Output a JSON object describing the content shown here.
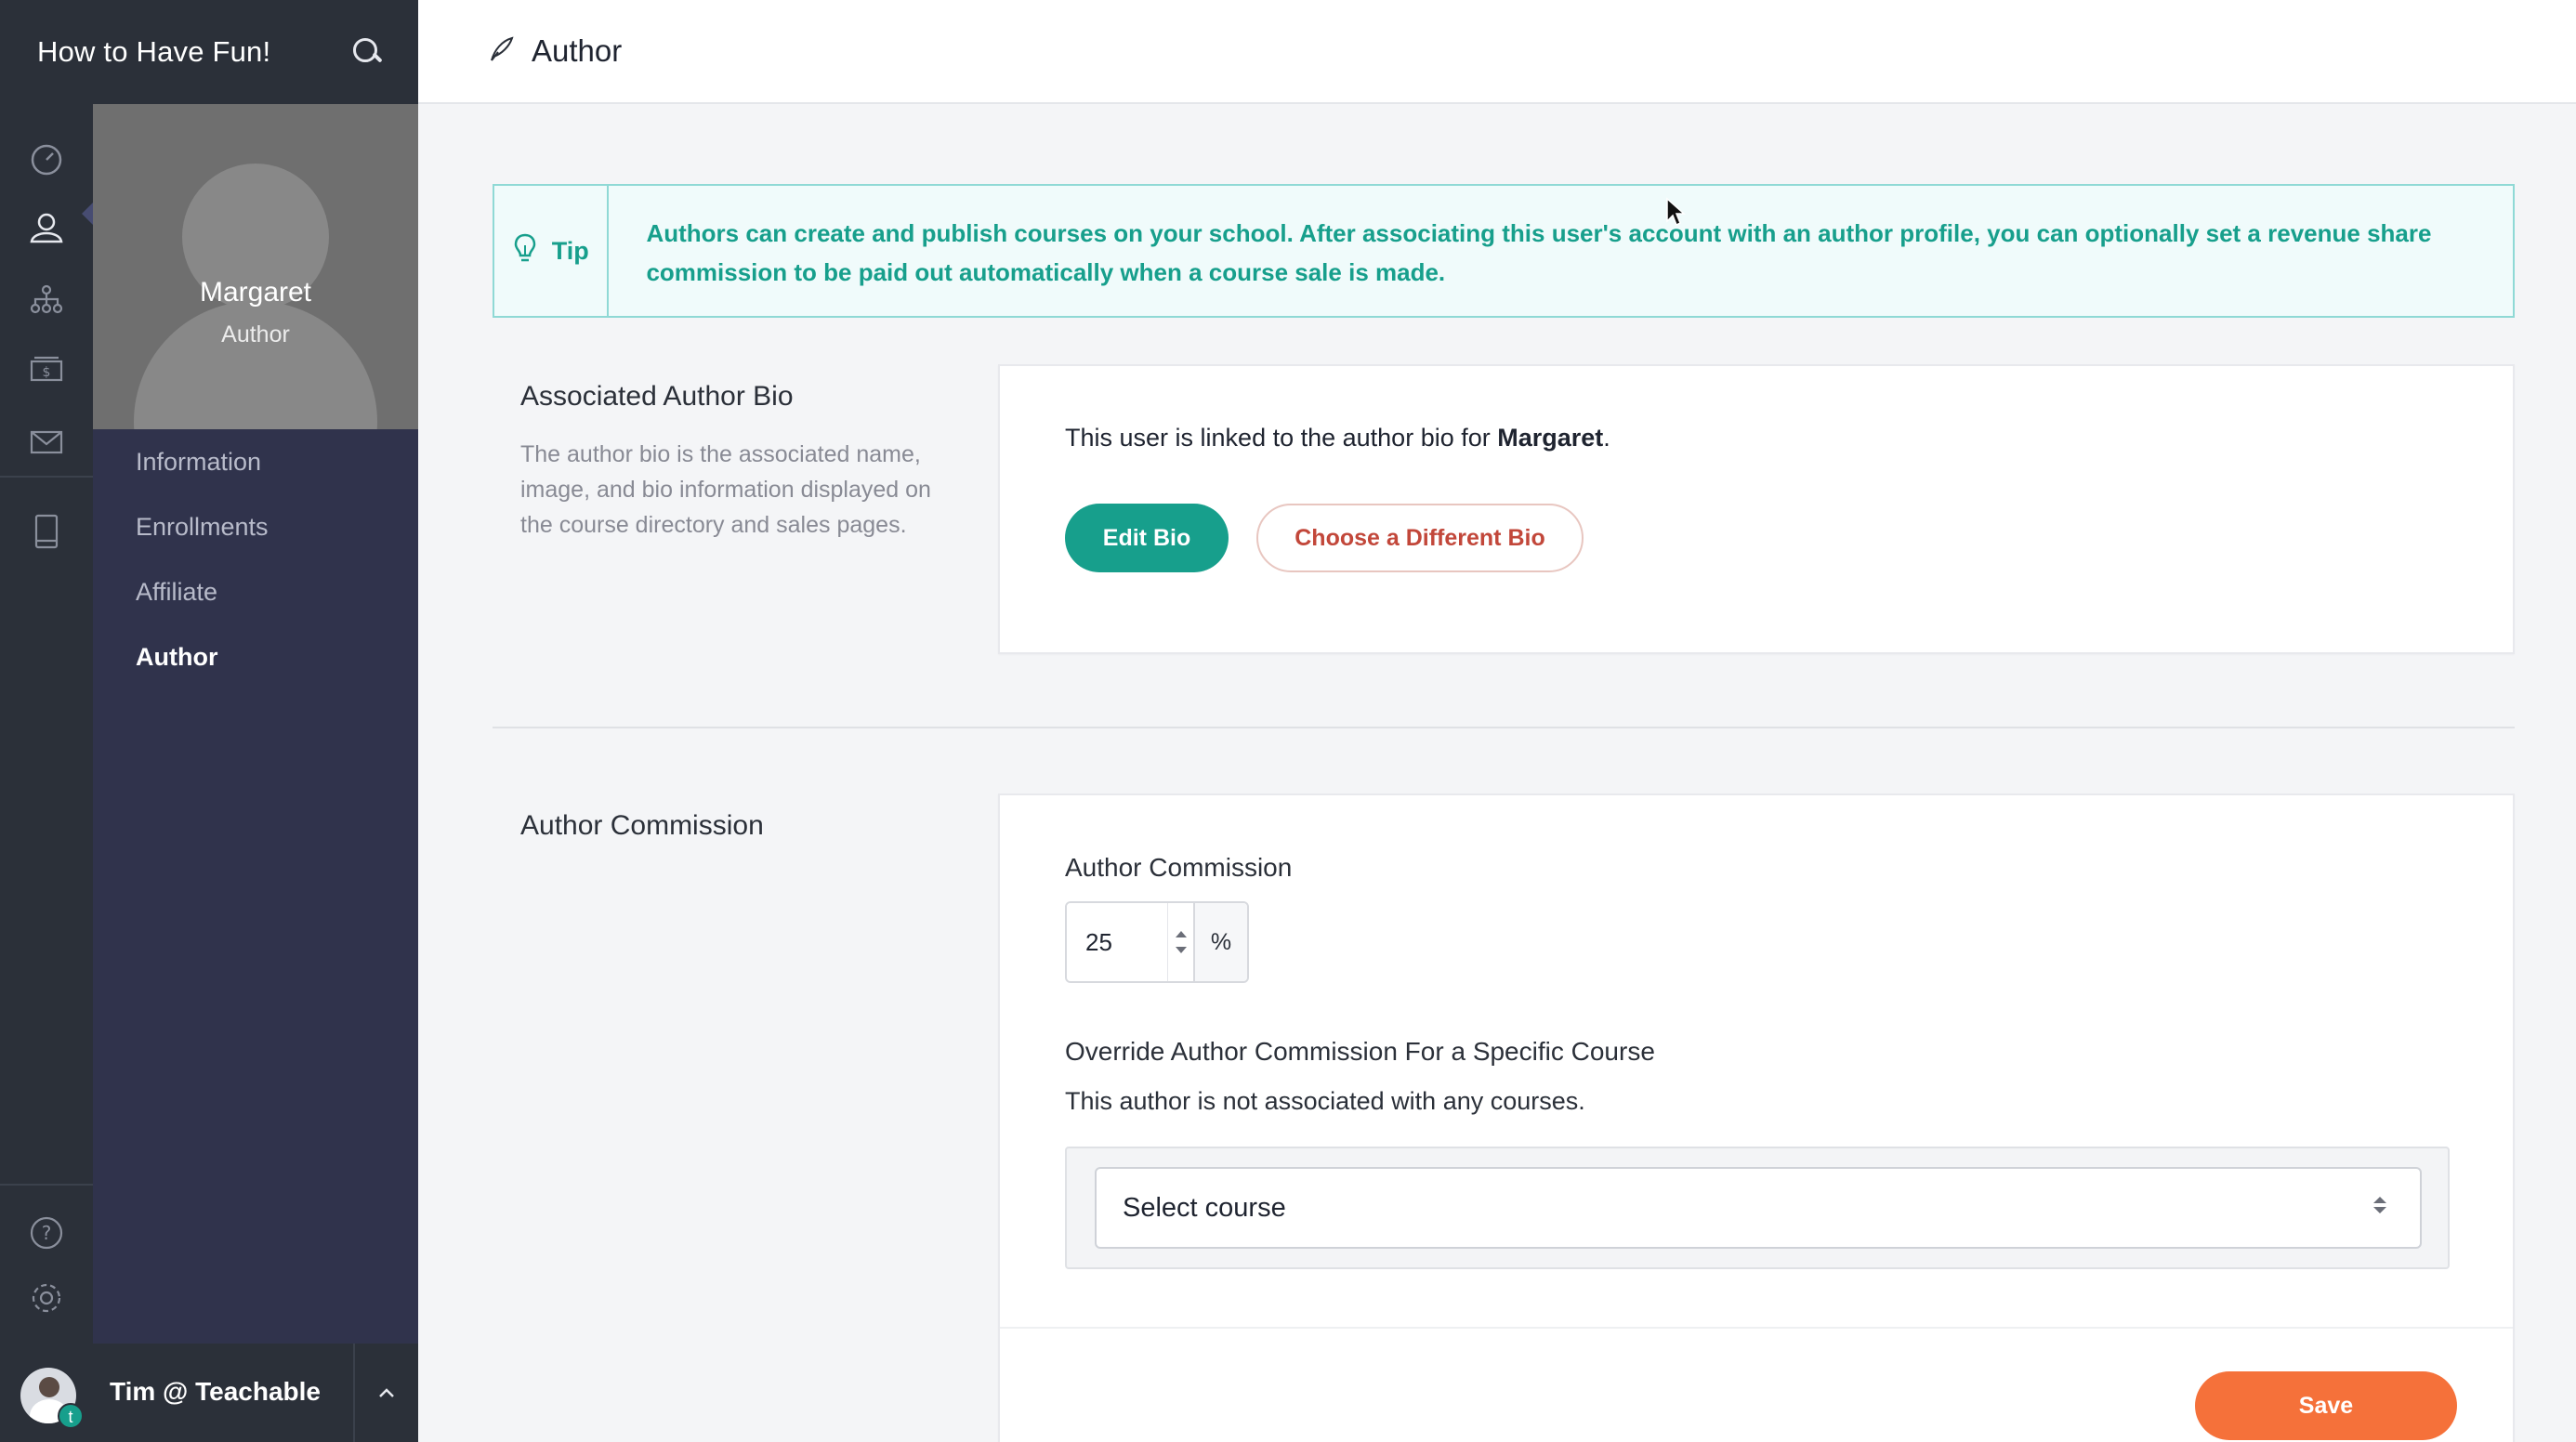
{
  "brand": {
    "title": "How to Have Fun!"
  },
  "rail": {
    "icons": [
      "dashboard-icon",
      "users-icon",
      "sitemap-icon",
      "money-icon",
      "mail-icon",
      "tablet-icon",
      "help-icon",
      "settings-icon"
    ]
  },
  "profile": {
    "name": "Margaret",
    "role": "Author"
  },
  "subnav": {
    "items": [
      {
        "label": "Information"
      },
      {
        "label": "Enrollments"
      },
      {
        "label": "Affiliate"
      },
      {
        "label": "Author"
      }
    ],
    "active": "Author"
  },
  "user": {
    "name": "Tim @ Teachable",
    "badge": "t"
  },
  "header": {
    "title": "Author",
    "icon": "quill-icon"
  },
  "tip": {
    "label": "Tip",
    "text": "Authors can create and publish courses on your school. After associating this user's account with an author profile, you can optionally set a revenue share commission to be paid out automatically when a course sale is made."
  },
  "bio_section": {
    "title": "Associated Author Bio",
    "description": "The author bio is the associated name, image, and bio information displayed on the course directory and sales pages.",
    "linked_prefix": "This user is linked to the author bio for ",
    "linked_name": "Margaret",
    "linked_suffix": ".",
    "edit_label": "Edit Bio",
    "choose_label": "Choose a Different Bio"
  },
  "commission_section": {
    "title": "Author Commission",
    "field_label": "Author Commission",
    "value": "25",
    "suffix": "%",
    "override_label": "Override Author Commission For a Specific Course",
    "note": "This author is not associated with any courses.",
    "select_value": "Select course",
    "save_label": "Save"
  },
  "colors": {
    "teal": "#179f8c",
    "orange": "#f5713a",
    "sidebar": "#30334c",
    "rail": "#2b3039"
  }
}
